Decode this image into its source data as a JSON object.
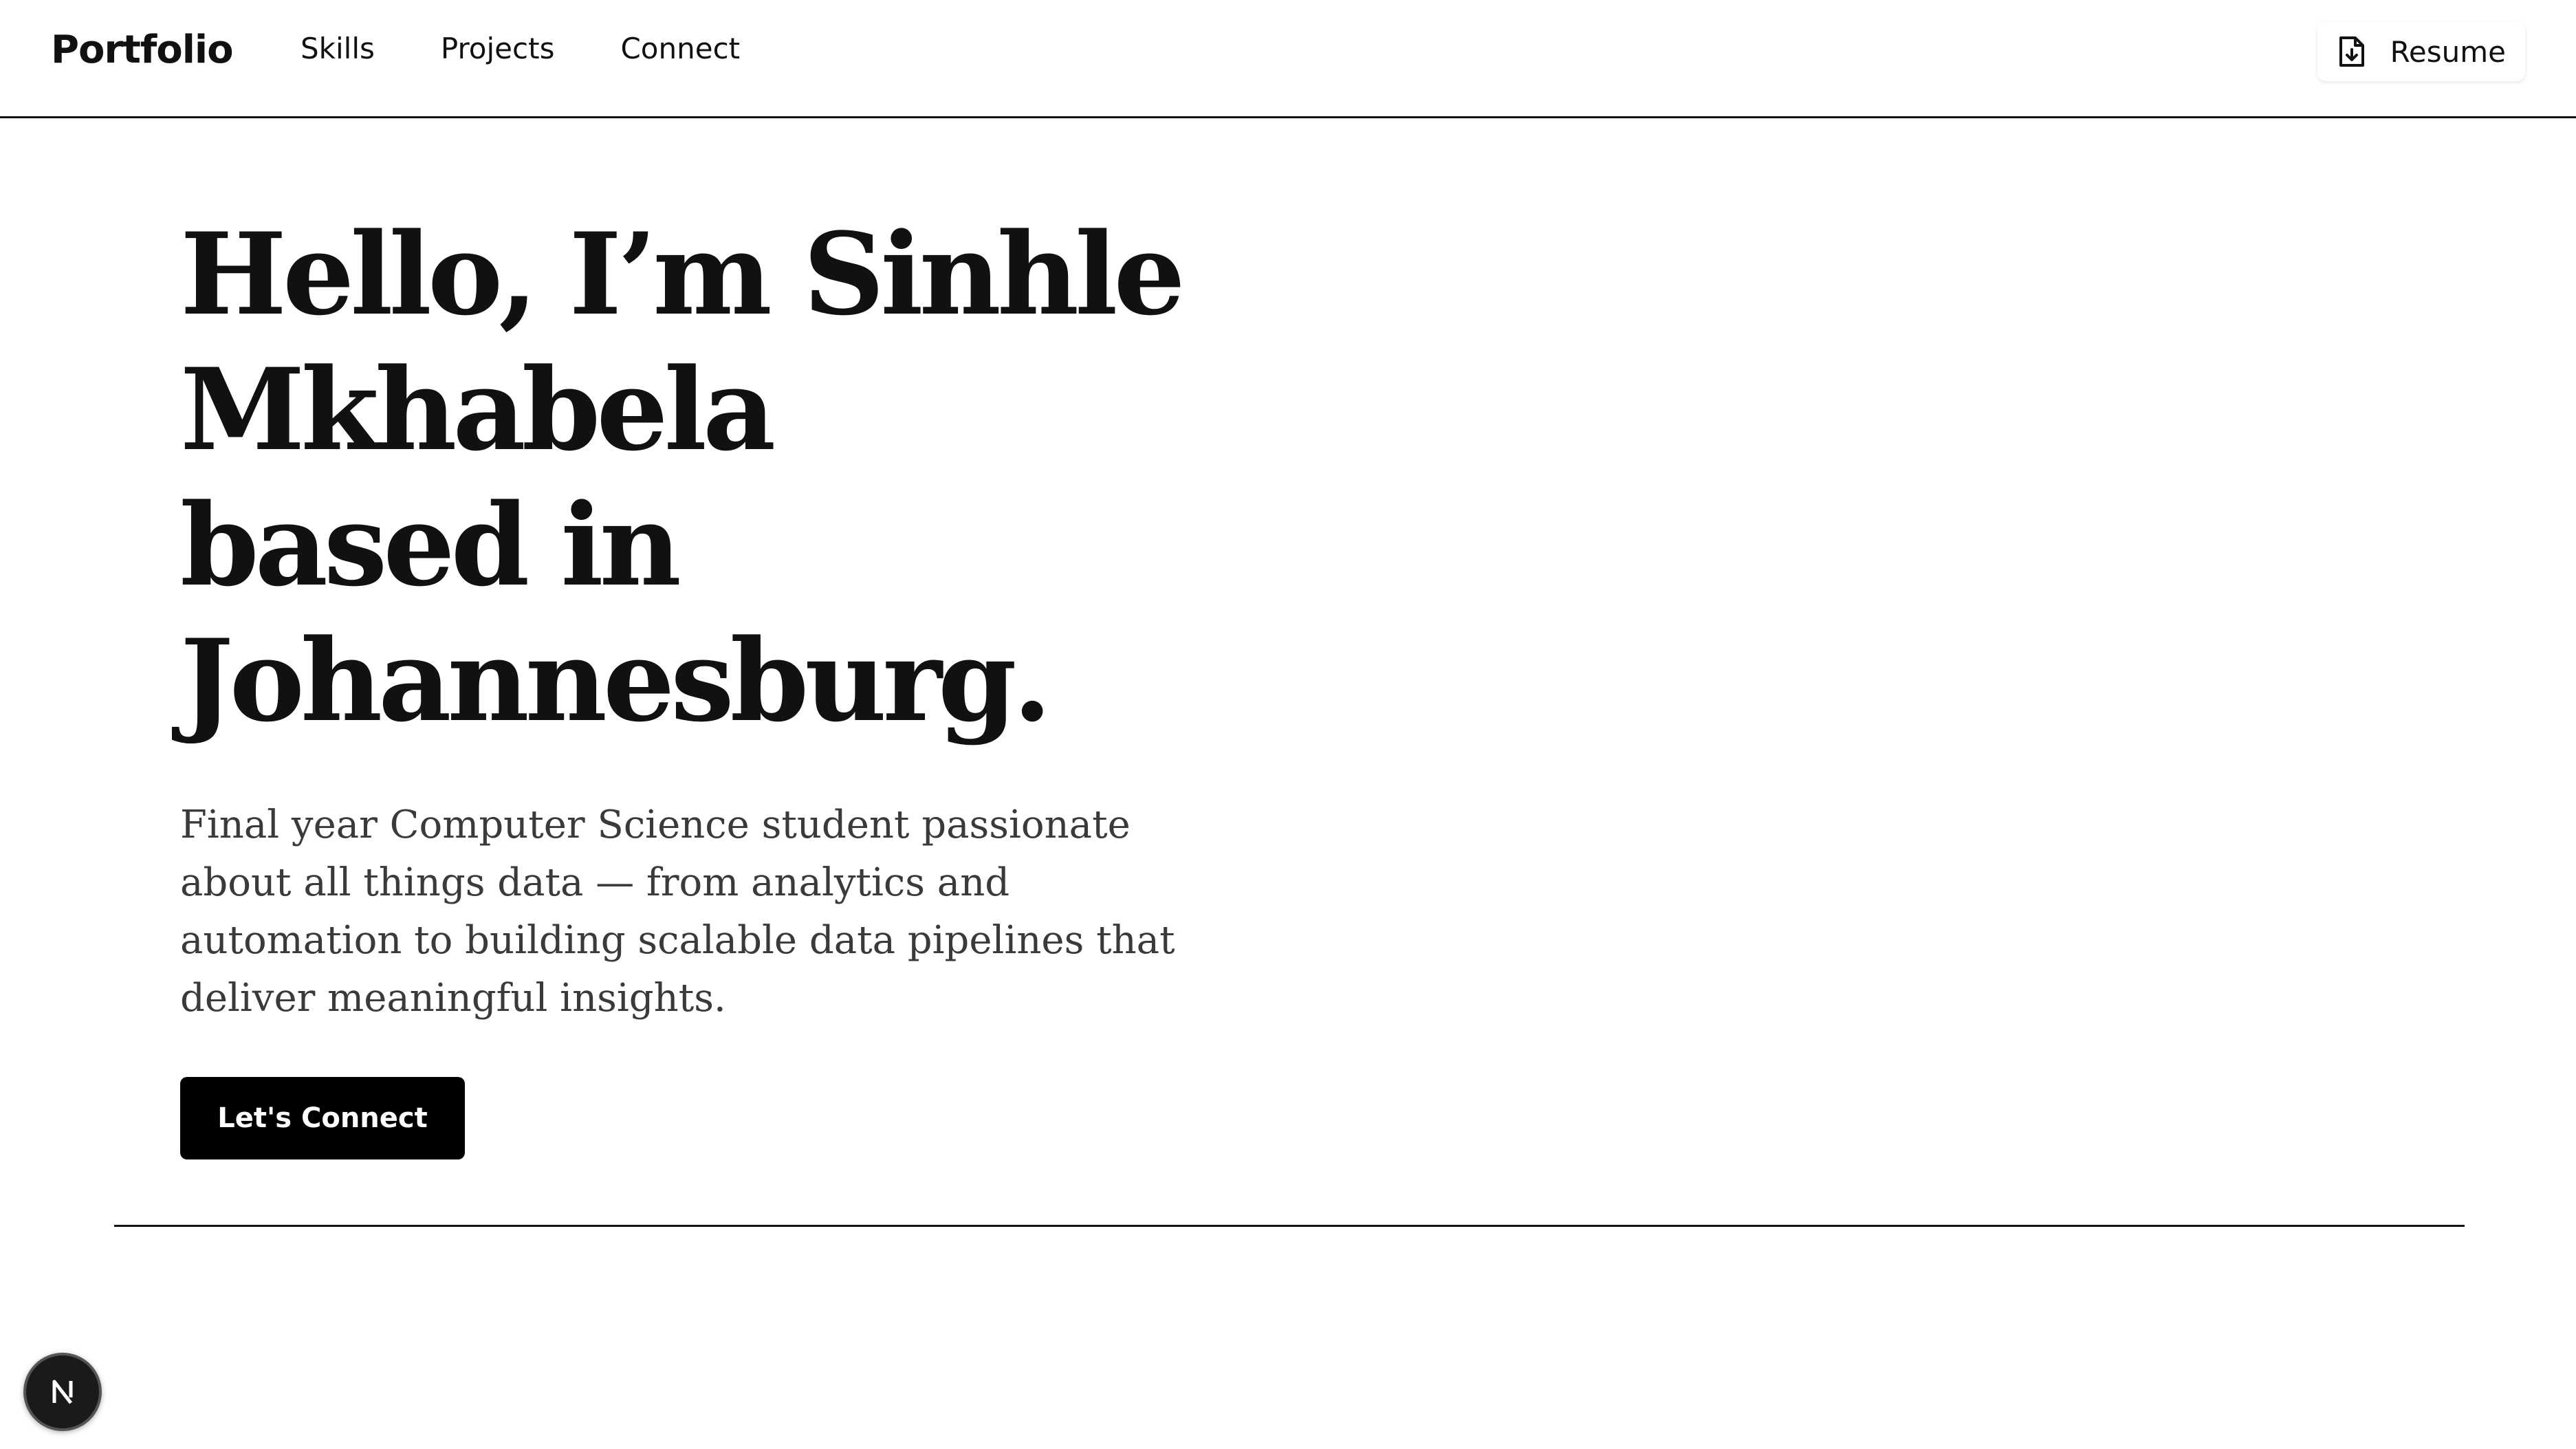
{
  "nav": {
    "brand": "Portfolio",
    "links": [
      {
        "label": "Skills"
      },
      {
        "label": "Projects"
      },
      {
        "label": "Connect"
      }
    ],
    "resume": {
      "label": "Resume",
      "icon": "file-download-icon"
    }
  },
  "hero": {
    "title_lines": [
      "Hello, I’m Sinhle",
      "Mkhabela",
      "based in",
      "Johannesburg."
    ],
    "description": "Final year Computer Science student passionate about all things data — from analytics and automation to building scalable data pipelines that deliver meaningful insights.",
    "cta_label": "Let's Connect"
  },
  "dev_badge": {
    "letter": "N",
    "icon": "nextjs-logo-icon"
  },
  "colors": {
    "text": "#111111",
    "muted_text": "#3a3a3a",
    "button_bg": "#000000",
    "button_text": "#ffffff",
    "background": "#ffffff"
  }
}
